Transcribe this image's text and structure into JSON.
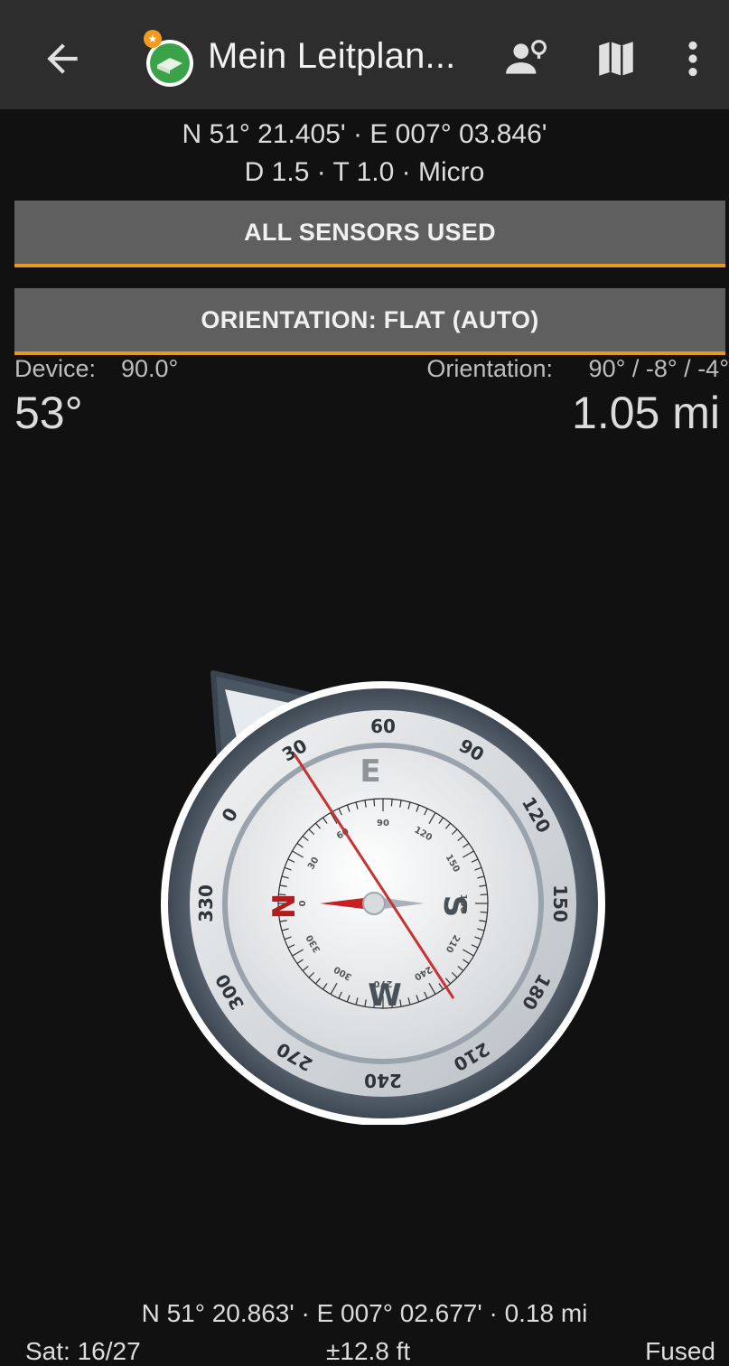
{
  "appbar": {
    "title": "Mein Leitplan...",
    "icons": [
      "back-arrow-icon",
      "cache-logo-icon",
      "person-hint-icon",
      "map-icon",
      "overflow-menu-icon"
    ]
  },
  "cache": {
    "coords": "N 51° 21.405' · E 007° 03.846'",
    "details": "D 1.5 · T 1.0 · Micro"
  },
  "buttons": {
    "sensors": "ALL SENSORS USED",
    "orientation": "ORIENTATION: FLAT (AUTO)"
  },
  "readouts": {
    "device_label": "Device:",
    "device_value": "90.0°",
    "orientation_label": "Orientation:",
    "orientation_value": "90° /  -8° /  -4°",
    "bearing": "53°",
    "distance": "1.05 mi"
  },
  "compass": {
    "outer_ticks": [
      "0",
      "30",
      "60",
      "90",
      "120",
      "150",
      "180",
      "210",
      "240",
      "270",
      "300",
      "330"
    ],
    "inner_ticks": [
      "30",
      "60",
      "90",
      "120",
      "150",
      "180",
      "210",
      "240",
      "270",
      "300",
      "330",
      "0"
    ],
    "letters": {
      "north": "N",
      "east": "E",
      "south": "S",
      "west": "W"
    },
    "accent_color": "#c62020"
  },
  "footer": {
    "position": "N 51° 20.863' · E 007° 02.677' · 0.18 mi",
    "satellites": "Sat: 16/27",
    "accuracy": "±12.8 ft",
    "provider": "Fused"
  },
  "colors": {
    "accent": "#e29a22",
    "appbar": "#2d2d2d",
    "background": "#111111"
  }
}
